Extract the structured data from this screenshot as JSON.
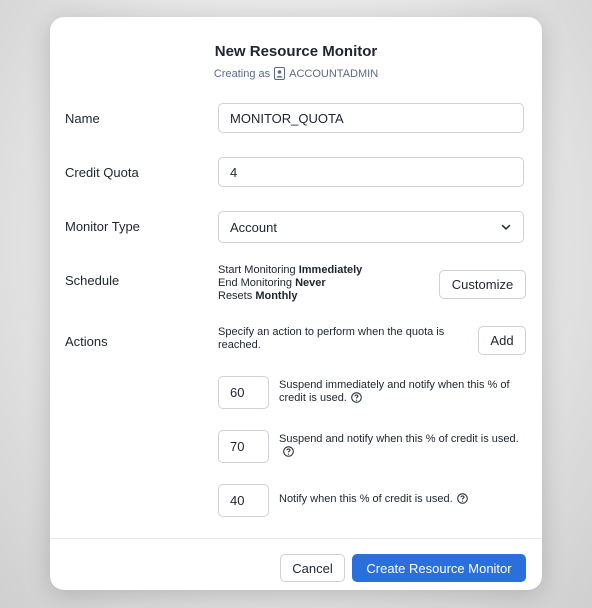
{
  "dialog": {
    "title": "New Resource Monitor",
    "creating_as_prefix": "Creating as",
    "role": "ACCOUNTADMIN"
  },
  "form": {
    "name_label": "Name",
    "name_value": "MONITOR_QUOTA",
    "credit_quota_label": "Credit Quota",
    "credit_quota_value": "4",
    "monitor_type_label": "Monitor Type",
    "monitor_type_value": "Account",
    "schedule_label": "Schedule",
    "schedule": {
      "start_prefix": "Start Monitoring",
      "start_value": "Immediately",
      "end_prefix": "End Monitoring",
      "end_value": "Never",
      "resets_prefix": "Resets",
      "resets_value": "Monthly"
    },
    "customize_label": "Customize",
    "actions_label": "Actions",
    "actions_description": "Specify an action to perform when the quota is reached.",
    "add_label": "Add",
    "actions": [
      {
        "value": "60",
        "text": "Suspend immediately and notify when this % of credit is used."
      },
      {
        "value": "70",
        "text": "Suspend and notify when this % of credit is used."
      },
      {
        "value": "40",
        "text": "Notify when this % of credit is used."
      }
    ]
  },
  "footer": {
    "cancel_label": "Cancel",
    "create_label": "Create Resource Monitor"
  },
  "colors": {
    "primary": "#2a6fdb",
    "border": "#cdd1d8",
    "text": "#1e252f"
  }
}
